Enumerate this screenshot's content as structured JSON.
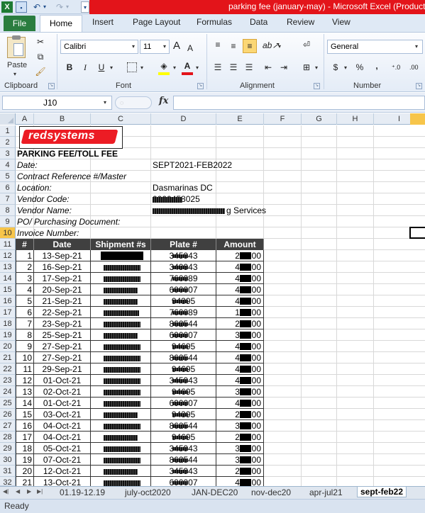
{
  "window": {
    "title": "parking fee (january-may)  -  Microsoft Excel (Product"
  },
  "quick_access": {
    "excel": "X",
    "save": "▪",
    "undo": "↶",
    "redo": "↷",
    "dropdown": "▾",
    "customize": "▾"
  },
  "tabs": {
    "file": "File",
    "home": "Home",
    "insert": "Insert",
    "page_layout": "Page Layout",
    "formulas": "Formulas",
    "data": "Data",
    "review": "Review",
    "view": "View"
  },
  "ribbon": {
    "clipboard": {
      "label": "Clipboard",
      "paste": "Paste"
    },
    "font": {
      "label": "Font",
      "name": "Calibri",
      "size": "11",
      "bold": "B",
      "italic": "I",
      "underline": "U",
      "grow": "A",
      "shrink": "A"
    },
    "alignment": {
      "label": "Alignment"
    },
    "number": {
      "label": "Number",
      "format": "General",
      "currency": "$",
      "percent": "%",
      "comma": ",",
      "inc_decimal": "⁺.0",
      "dec_decimal": ".00"
    }
  },
  "formula_bar": {
    "name_box": "J10",
    "fx": "fx",
    "value": ""
  },
  "columns": [
    "A",
    "B",
    "C",
    "D",
    "E",
    "F",
    "G",
    "H",
    "I"
  ],
  "rows": [
    "1",
    "2",
    "3",
    "4",
    "5",
    "6",
    "7",
    "8",
    "9",
    "10",
    "11",
    "12",
    "13",
    "14",
    "15",
    "16",
    "17",
    "18",
    "19",
    "20",
    "21",
    "22",
    "23",
    "24",
    "25",
    "26",
    "27",
    "28",
    "29",
    "30",
    "31",
    "32"
  ],
  "logo": {
    "text": "redsystems"
  },
  "sheet": {
    "title": "PARKING FEE/TOLL FEE",
    "date_label": "Date:",
    "date_value": "SEPT2021-FEB2022",
    "contract_label": "Contract Reference #/Master",
    "location_label": "Location:",
    "location_value": "Dasmarinas DC",
    "vendor_code_label": "Vendor Code:",
    "vendor_code_value": "0000458025",
    "vendor_name_label": "Vendor Name:",
    "vendor_name_value": "g Services",
    "po_label": "PO/ Purchasing Document:",
    "invoice_label": "Invoice Number:"
  },
  "table": {
    "headers": [
      "#",
      "Date",
      "Shipment #s",
      "Plate #",
      "Amount"
    ],
    "rows": [
      {
        "n": "1",
        "date": "13-Sep-21",
        "plate": "345943",
        "amount": "200.00"
      },
      {
        "n": "2",
        "date": "16-Sep-21",
        "plate": "349943",
        "amount": "400.00"
      },
      {
        "n": "3",
        "date": "17-Sep-21",
        "plate": "760089",
        "amount": "400.00"
      },
      {
        "n": "4",
        "date": "20-Sep-21",
        "plate": "600007",
        "amount": "400.00"
      },
      {
        "n": "5",
        "date": "21-Sep-21",
        "plate": "94395",
        "amount": "400.00"
      },
      {
        "n": "6",
        "date": "22-Sep-21",
        "plate": "760089",
        "amount": "100.00"
      },
      {
        "n": "7",
        "date": "23-Sep-21",
        "plate": "862544",
        "amount": "270.00"
      },
      {
        "n": "8",
        "date": "25-Sep-21",
        "plate": "600007",
        "amount": "370.00"
      },
      {
        "n": "9",
        "date": "27-Sep-21",
        "plate": "94695",
        "amount": "400.00"
      },
      {
        "n": "10",
        "date": "27-Sep-21",
        "plate": "862544",
        "amount": "495.00"
      },
      {
        "n": "11",
        "date": "29-Sep-21",
        "plate": "94695",
        "amount": "400.00"
      },
      {
        "n": "12",
        "date": "01-Oct-21",
        "plate": "345943",
        "amount": "400.00"
      },
      {
        "n": "13",
        "date": "02-Oct-21",
        "plate": "94695",
        "amount": "300.00"
      },
      {
        "n": "14",
        "date": "01-Oct-21",
        "plate": "600007",
        "amount": "400.00"
      },
      {
        "n": "15",
        "date": "03-Oct-21",
        "plate": "94395",
        "amount": "235.00"
      },
      {
        "n": "16",
        "date": "04-Oct-21",
        "plate": "862544",
        "amount": "300.00"
      },
      {
        "n": "17",
        "date": "04-Oct-21",
        "plate": "94695",
        "amount": "200.00"
      },
      {
        "n": "18",
        "date": "05-Oct-21",
        "plate": "345943",
        "amount": "300.00"
      },
      {
        "n": "19",
        "date": "07-Oct-21",
        "plate": "862544",
        "amount": "300.00"
      },
      {
        "n": "20",
        "date": "12-Oct-21",
        "plate": "345943",
        "amount": "285.00"
      },
      {
        "n": "21",
        "date": "13-Oct-21",
        "plate": "600007",
        "amount": "400.00"
      }
    ]
  },
  "sheet_tabs": [
    "01.19-12.19",
    "july-oct2020",
    "JAN-DEC20",
    "nov-dec20",
    "apr-jul21",
    "sept-feb22"
  ],
  "status": {
    "text": "Ready"
  }
}
